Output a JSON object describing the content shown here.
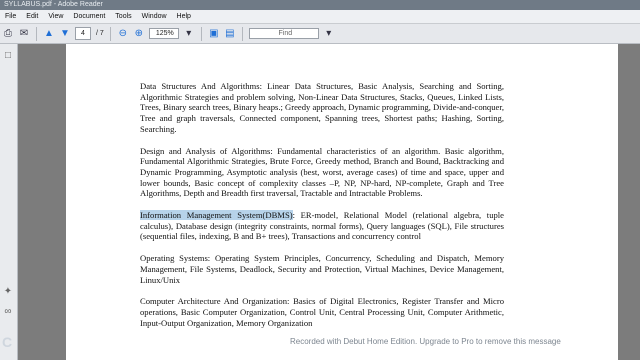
{
  "window": {
    "title": "SYLLABUS.pdf - Adobe Reader"
  },
  "menu": [
    "File",
    "Edit",
    "View",
    "Document",
    "Tools",
    "Window",
    "Help"
  ],
  "toolbar": {
    "current_page": "4",
    "total_pages": "/ 7",
    "zoom": "125%",
    "find_placeholder": "Find"
  },
  "document": {
    "paragraphs": [
      {
        "text": "Data Structures And Algorithms: Linear Data Structures, Basic Analysis, Searching and Sorting, Algorithmic Strategies and problem solving, Non-Linear Data Structures, Stacks, Queues, Linked Lists, Trees, Binary search trees, Binary heaps.; Greedy approach, Dynamic programming, Divide-and-conquer, Tree and graph traversals, Connected component, Spanning trees, Shortest paths; Hashing, Sorting, Searching."
      },
      {
        "text": "Design and Analysis of Algorithms: Fundamental characteristics of an algorithm. Basic algorithm, Fundamental Algorithmic Strategies, Brute Force, Greedy method, Branch and Bound, Backtracking and Dynamic Programming, Asymptotic analysis (best, worst, average cases) of time and space, upper and lower bounds, Basic concept of complexity classes –P, NP, NP-hard, NP-complete, Graph and Tree Algorithms, Depth and Breadth first traversal, Tractable and Intractable Problems."
      },
      {
        "highlight": "Information Management System(DBMS)",
        "text": ": ER-model, Relational Model (relational algebra, tuple calculus), Database design (integrity constraints, normal forms), Query languages (SQL), File structures (sequential files, indexing, B and B+ trees), Transactions and concurrency control"
      },
      {
        "text": "Operating Systems: Operating System Principles, Concurrency, Scheduling and Dispatch, Memory Management, File Systems, Deadlock, Security and Protection, Virtual Machines, Device Management, Linux/Unix"
      },
      {
        "text": "Computer Architecture And Organization: Basics of Digital Electronics, Register Transfer and Micro operations, Basic Computer Organization, Control Unit, Central Processing Unit, Computer Arithmetic, Input-Output Organization, Memory Organization"
      }
    ]
  },
  "watermark": {
    "text": "Recorded with Debut Home Edition. Upgrade to Pro to remove this message"
  },
  "colors": {
    "highlight": "#b7d3ea",
    "gutter": "#7c7c7c",
    "title_bar": "#6f7a86"
  }
}
